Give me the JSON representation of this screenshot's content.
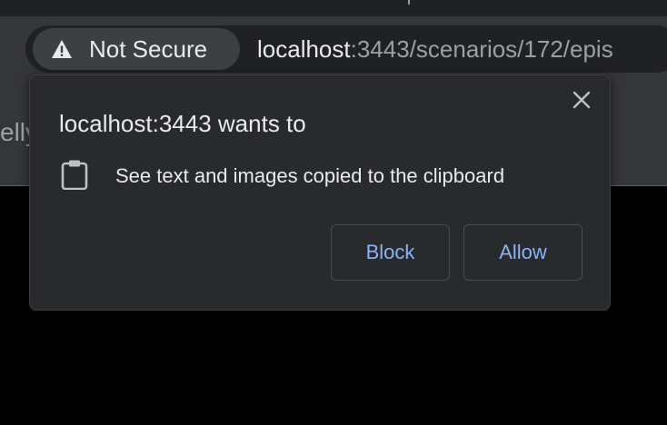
{
  "address_bar": {
    "security_label": "Not Secure",
    "security_icon": "warning-triangle-icon",
    "url_host": "localhost",
    "url_rest": ":3443/scenarios/172/epis"
  },
  "page": {
    "partial_text": "elly"
  },
  "permission_bubble": {
    "title": "localhost:3443 wants to",
    "close_icon": "close-icon",
    "permission_icon": "clipboard-icon",
    "permission_text": "See text and images copied to the clipboard",
    "block_label": "Block",
    "allow_label": "Allow"
  },
  "colors": {
    "accent": "#8ab4f8",
    "bubble_bg": "#292a2d",
    "toolbar_bg": "#35363a",
    "text": "#e8eaed"
  }
}
